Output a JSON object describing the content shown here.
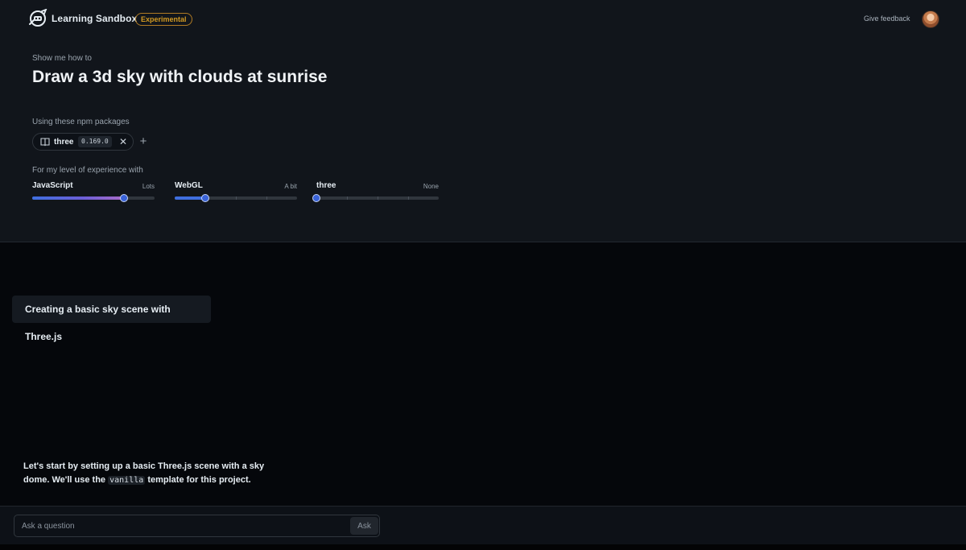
{
  "header": {
    "app_title": "Learning Sandbox",
    "badge": "Experimental",
    "feedback_link": "Give feedback",
    "logo_icon": "robot-logo-icon",
    "avatar_icon": "user-avatar"
  },
  "prompt": {
    "lead": "Show me how to",
    "title": "Draw a 3d sky with clouds at sunrise"
  },
  "packages": {
    "label": "Using these npm packages",
    "items": [
      {
        "name": "three",
        "version": "0.169.0",
        "icon": "book-icon",
        "remove_icon": "close-icon"
      }
    ],
    "add_icon": "plus-icon"
  },
  "experience": {
    "label": "For my level of experience with",
    "sliders": [
      {
        "name": "JavaScript",
        "level": "Lots",
        "value": 0.75
      },
      {
        "name": "WebGL",
        "level": "A bit",
        "value": 0.25
      },
      {
        "name": "three",
        "level": "None",
        "value": 0.0
      }
    ]
  },
  "conversation": {
    "step_title": "Creating a basic sky scene with Three.js",
    "message": {
      "before": "Let's start by setting up a basic Three.js scene with a sky dome. We'll use the ",
      "code": "vanilla",
      "after": " template for this project."
    }
  },
  "ask": {
    "placeholder": "Ask a question",
    "button_label": "Ask"
  },
  "colors": {
    "accent_blue": "#3f6fe0",
    "badge_orange": "#d29922",
    "panel_bg": "#11151b",
    "page_bg": "#05070b"
  }
}
